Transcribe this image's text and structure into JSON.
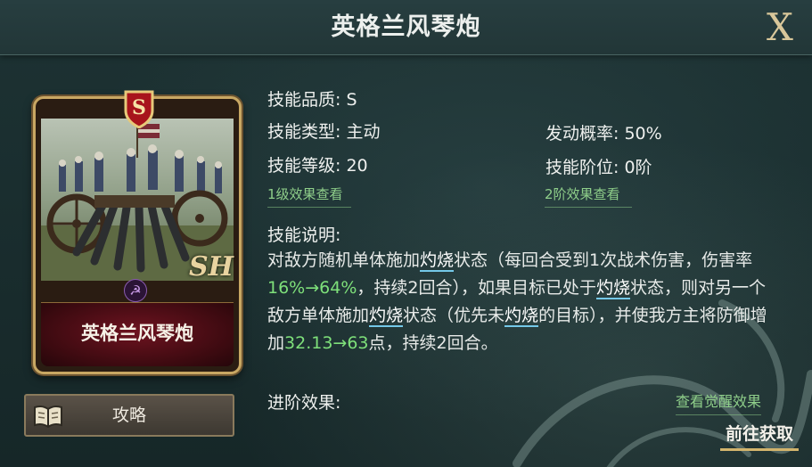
{
  "window": {
    "title": "英格兰风琴炮",
    "close_label": "X"
  },
  "card": {
    "name": "英格兰风琴炮",
    "grade": "S",
    "signature": "SH",
    "camp_icon": "hammer-sickle-icon"
  },
  "guide_button": {
    "label": "攻略",
    "icon": "book-icon"
  },
  "skill": {
    "quality": "技能品质: S",
    "type": "技能类型: 主动",
    "level": "技能等级: 20",
    "trigger_rate": "发动概率: 50%",
    "rank": "技能阶位: 0阶",
    "level1_link": "1级效果查看",
    "rank2_link": "2阶效果查看",
    "desc_title": "技能说明:",
    "description": {
      "p1": "对敌方随机单体施加",
      "kw1": "灼烧",
      "p2": "状态（每回合受到1次战术伤害，伤害率",
      "n1": "16%→64%",
      "p3": "，持续2回合），如果目标已处于",
      "kw2": "灼烧",
      "p4": "状态，则对另一个敌方单体施加",
      "kw3": "灼烧",
      "p5": "状态（优先未",
      "kw4": "灼烧",
      "p6": "的目标），并使我方主将防御增加",
      "n2": "32.13→63",
      "p7": "点，持续2回合。"
    },
    "advance_title": "进阶效果:",
    "awaken_link": "查看觉醒效果",
    "acquire_button": "前往获取"
  },
  "colors": {
    "accent_gold": "#d2b46c",
    "link_green": "#8fcf8a",
    "number_green": "#7ee07a",
    "keyword_underline": "#74c8e8"
  }
}
